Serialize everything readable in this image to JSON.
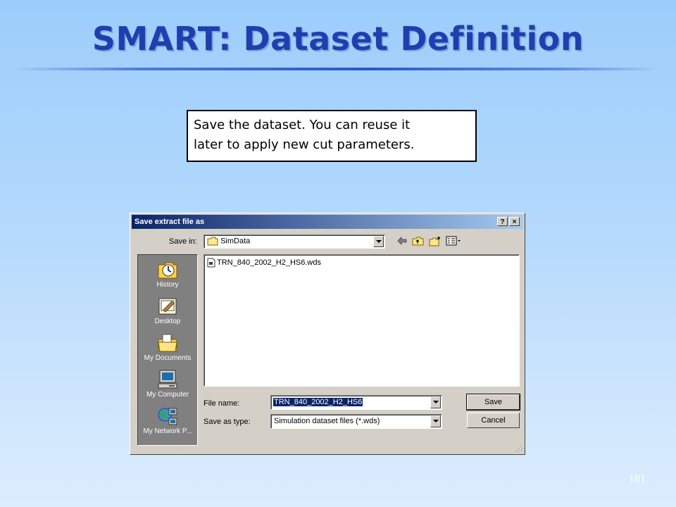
{
  "slide": {
    "title": "SMART: Dataset Definition",
    "callout_line1": "Save the dataset. You can reuse it",
    "callout_line2": "later to apply new cut parameters.",
    "page_number": "181"
  },
  "dialog": {
    "title": "Save extract file as",
    "help_button": "?",
    "close_button": "×",
    "save_in_label": "Save in:",
    "save_in_value": "SimData",
    "toolbar_icons": [
      "back-arrow-icon",
      "up-folder-icon",
      "new-folder-icon",
      "view-menu-icon"
    ],
    "places": [
      {
        "label": "History",
        "icon": "history-icon"
      },
      {
        "label": "Desktop",
        "icon": "desktop-icon"
      },
      {
        "label": "My Documents",
        "icon": "my-documents-icon"
      },
      {
        "label": "My Computer",
        "icon": "my-computer-icon"
      },
      {
        "label": "My Network P...",
        "icon": "my-network-icon"
      }
    ],
    "files": [
      {
        "name": "TRN_840_2002_H2_HS6.wds",
        "icon": "file-icon"
      }
    ],
    "file_name_label": "File name:",
    "file_name_value": "TRN_840_2002_H2_HS6",
    "save_type_label": "Save as type:",
    "save_type_value": "Simulation dataset files (*.wds)",
    "save_button": "Save",
    "cancel_button": "Cancel"
  },
  "colors": {
    "title_text": "#1f3fb0",
    "titlebar_start": "#0a246a",
    "titlebar_end": "#a6caf0",
    "dialog_face": "#d4d0c8"
  }
}
